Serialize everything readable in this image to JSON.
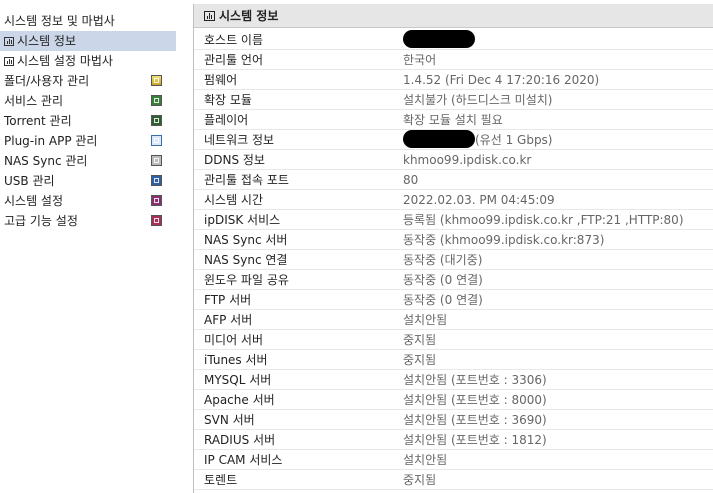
{
  "sidebar": {
    "items": [
      {
        "label": "시스템 정보 및 마법사",
        "selected": false
      },
      {
        "label": "시스템 정보",
        "selected": true,
        "icon": "chart-icon"
      },
      {
        "label": "시스템 설정 마법사",
        "selected": false,
        "icon": "chart-icon"
      },
      {
        "label": "폴더/사용자 관리",
        "icon": "folder-icon"
      },
      {
        "label": "서비스 관리",
        "icon": "service-icon"
      },
      {
        "label": "Torrent 관리",
        "icon": "torrent-icon"
      },
      {
        "label": "Plug-in APP 관리",
        "icon": "plugin-icon"
      },
      {
        "label": "NAS Sync 관리",
        "icon": "nas-sync-icon"
      },
      {
        "label": "USB 관리",
        "icon": "usb-icon"
      },
      {
        "label": "시스템 설정",
        "icon": "system-settings-icon"
      },
      {
        "label": "고급 기능 설정",
        "icon": "advanced-settings-icon"
      }
    ]
  },
  "panel": {
    "title": "시스템 정보",
    "rows": [
      {
        "label": "호스트 이름",
        "value": ""
      },
      {
        "label": "관리툴 언어",
        "value": "한국어"
      },
      {
        "label": "펌웨어",
        "value": "1.4.52 (Fri Dec 4 17:20:16 2020)"
      },
      {
        "label": "확장 모듈",
        "value": "설치불가 (하드디스크 미설치)"
      },
      {
        "label": "플레이어",
        "value": "확장 모듈 설치 필요"
      },
      {
        "label": "네트워크 정보",
        "value": "(유선 1 Gbps)"
      },
      {
        "label": "DDNS 정보",
        "value": "khmoo99.ipdisk.co.kr"
      },
      {
        "label": "관리툴 접속 포트",
        "value": "80"
      },
      {
        "label": "시스템 시간",
        "value": "2022.02.03. PM 04:45:09"
      },
      {
        "label": "ipDISK 서비스",
        "value": "등록됨 (khmoo99.ipdisk.co.kr ,FTP:21 ,HTTP:80)"
      },
      {
        "label": "NAS Sync 서버",
        "value": "동작중 (khmoo99.ipdisk.co.kr:873)"
      },
      {
        "label": "NAS Sync 연결",
        "value": "동작중 (대기중)"
      },
      {
        "label": "윈도우 파일 공유",
        "value": "동작중 (0 연결)"
      },
      {
        "label": "FTP 서버",
        "value": "동작중 (0 연결)"
      },
      {
        "label": "AFP 서버",
        "value": "설치안됨"
      },
      {
        "label": "미디어 서버",
        "value": "중지됨"
      },
      {
        "label": "iTunes 서버",
        "value": "중지됨"
      },
      {
        "label": "MYSQL 서버",
        "value": "설치안됨 (포트번호 : 3306)"
      },
      {
        "label": "Apache 서버",
        "value": "설치안됨 (포트번호 : 8000)"
      },
      {
        "label": "SVN 서버",
        "value": "설치안됨 (포트번호 : 3690)"
      },
      {
        "label": "RADIUS 서버",
        "value": "설치안됨 (포트번호 : 1812)"
      },
      {
        "label": "IP CAM 서비스",
        "value": "설치안됨"
      },
      {
        "label": "토렌트",
        "value": "중지됨"
      }
    ]
  },
  "colors": {
    "selected_bg": "#cbd6e8",
    "header_bg": "#e6e6e6",
    "value_text": "#666666"
  }
}
